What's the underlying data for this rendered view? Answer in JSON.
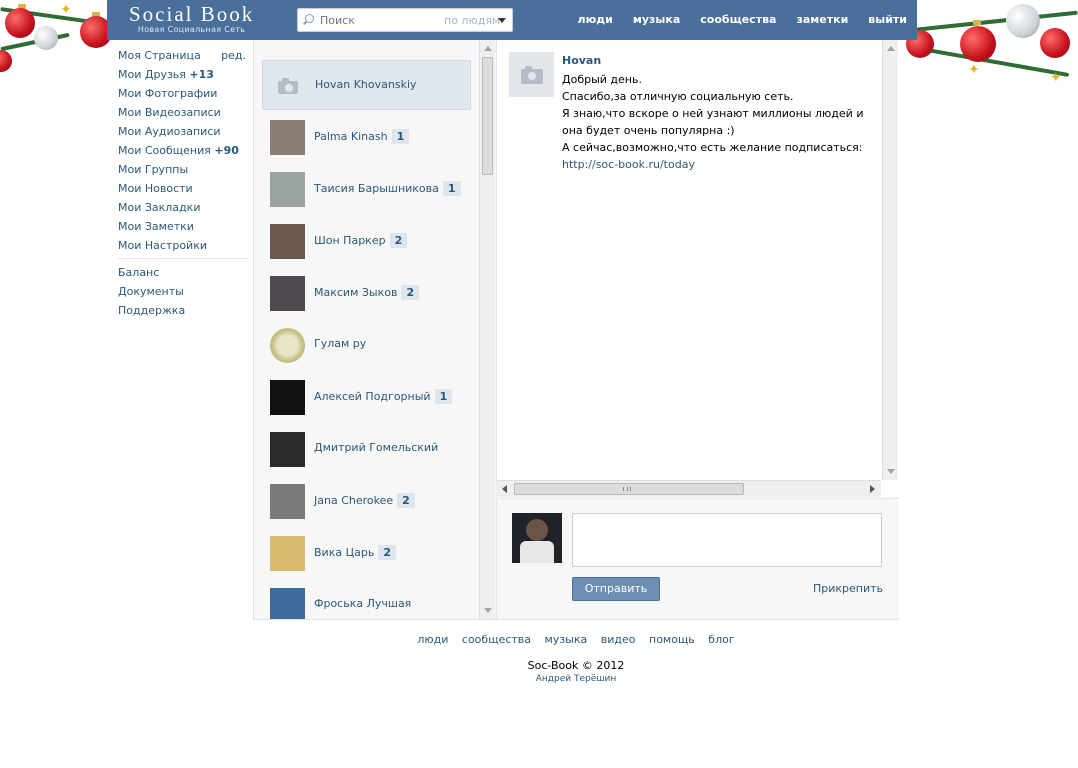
{
  "logo": {
    "name": "Social Book",
    "tagline": "Новая Социальная Сеть"
  },
  "search": {
    "placeholder": "Поиск",
    "scope": "по людям"
  },
  "topnav": [
    "люди",
    "музыка",
    "сообщества",
    "заметки",
    "выйти"
  ],
  "leftmenu": {
    "edit_label": "ред.",
    "items": [
      {
        "label": "Моя Страница",
        "count": ""
      },
      {
        "label": "Мои Друзья",
        "count": "+13"
      },
      {
        "label": "Мои Фотографии",
        "count": ""
      },
      {
        "label": "Мои Видеозаписи",
        "count": ""
      },
      {
        "label": "Мои Аудиозаписи",
        "count": ""
      },
      {
        "label": "Мои Сообщения",
        "count": "+90"
      },
      {
        "label": "Мои Группы",
        "count": ""
      },
      {
        "label": "Мои Новости",
        "count": ""
      },
      {
        "label": "Мои Закладки",
        "count": ""
      },
      {
        "label": "Мои Заметки",
        "count": ""
      },
      {
        "label": "Мои Настройки",
        "count": ""
      }
    ],
    "extra": [
      "Баланс",
      "Документы",
      "Поддержка"
    ]
  },
  "dialogs": [
    {
      "name": "Hovan Khovanskiy",
      "unread": "",
      "active": true,
      "avatar_color": ""
    },
    {
      "name": "Palma Kinash",
      "unread": "1",
      "avatar_color": "#8a7f72"
    },
    {
      "name": "Таисия Барышникова",
      "unread": "1",
      "avatar_color": "#9aa3a0"
    },
    {
      "name": "Шон Паркер",
      "unread": "2",
      "avatar_color": "#6b5a4e"
    },
    {
      "name": "Максим Зыков",
      "unread": "2",
      "avatar_color": "#4f4a52"
    },
    {
      "name": "Гулам ру",
      "unread": "",
      "avatar_color": "#c9c28a"
    },
    {
      "name": "Алексей Подгорный",
      "unread": "1",
      "avatar_color": "#111111"
    },
    {
      "name": "Дмитрий Гомельский",
      "unread": "",
      "avatar_color": "#2a2a2a"
    },
    {
      "name": "Jana Cherokee",
      "unread": "2",
      "avatar_color": "#7a7a7a"
    },
    {
      "name": "Вика Царь",
      "unread": "2",
      "avatar_color": "#d9b870"
    },
    {
      "name": "Фроська Лучшая",
      "unread": "",
      "avatar_color": "#3d6c9c"
    }
  ],
  "message": {
    "author": "Hovan",
    "lines": [
      "Добрый день.",
      "Спасибо,за отличную социальную сеть.",
      "Я знаю,что вскоре о ней узнают миллионы людей и она будет очень популярна :)"
    ],
    "last_line_prefix": "А сейчас,возможно,что есть желание подписаться: ",
    "link": "http://soc-book.ru/today"
  },
  "composer": {
    "send_label": "Отправить",
    "attach_label": "Прикрепить",
    "value": ""
  },
  "footer": {
    "links": [
      "люди",
      "сообщества",
      "музыка",
      "видео",
      "помощь",
      "блог"
    ],
    "copyright": "Soc-Book © 2012",
    "author": "Андрей Терёшин"
  },
  "colors": {
    "header": "#4a6f9a",
    "link": "#2b587a",
    "accent_button": "#6d8fb3"
  }
}
